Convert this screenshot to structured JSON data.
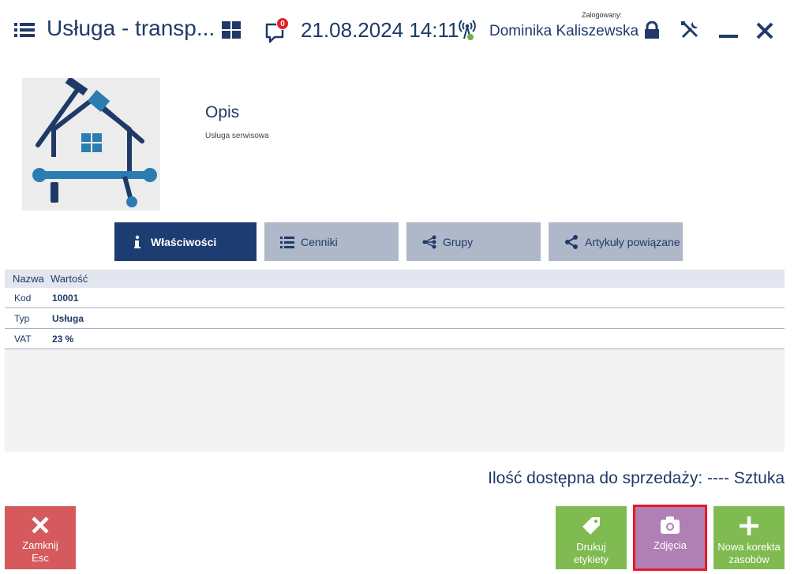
{
  "header": {
    "title": "Usługa - transp...",
    "notifications_count": "0",
    "datetime": "21.08.2024 14:11",
    "logged_label": "Zalogowany:",
    "user": "Dominika Kaliszewska"
  },
  "product": {
    "description_title": "Opis",
    "description_text": "Usługa serwisowa"
  },
  "tabs": [
    {
      "label": "Właściwości",
      "icon": "info-icon",
      "active": true
    },
    {
      "label": "Cenniki",
      "icon": "list-icon",
      "active": false
    },
    {
      "label": "Grupy",
      "icon": "groups-icon",
      "active": false
    },
    {
      "label": "Artykuły powiązane",
      "icon": "share-icon",
      "active": false
    }
  ],
  "table": {
    "columns": [
      "Nazwa",
      "Wartość"
    ],
    "rows": [
      {
        "name": "Kod",
        "value": "10001"
      },
      {
        "name": "Typ",
        "value": "Usługa"
      },
      {
        "name": "VAT",
        "value": "23 %"
      }
    ]
  },
  "availability": "Ilość dostępna do sprzedaży:  ---- Sztuka",
  "buttons": {
    "close": {
      "line1": "Zamknij",
      "line2": "Esc"
    },
    "print": {
      "line1": "Drukuj",
      "line2": "etykiety"
    },
    "photo": {
      "line1": "Zdjęcia"
    },
    "new_correction": {
      "line1": "Nowa korekta",
      "line2": "zasobów"
    }
  },
  "colors": {
    "primary": "#1d3c72",
    "tab_inactive": "#aeb8c9",
    "close_button": "#d65a5d",
    "green_button": "#7fbb50",
    "photo_button": "#b07fb4",
    "highlight_outline": "#e81a24"
  }
}
